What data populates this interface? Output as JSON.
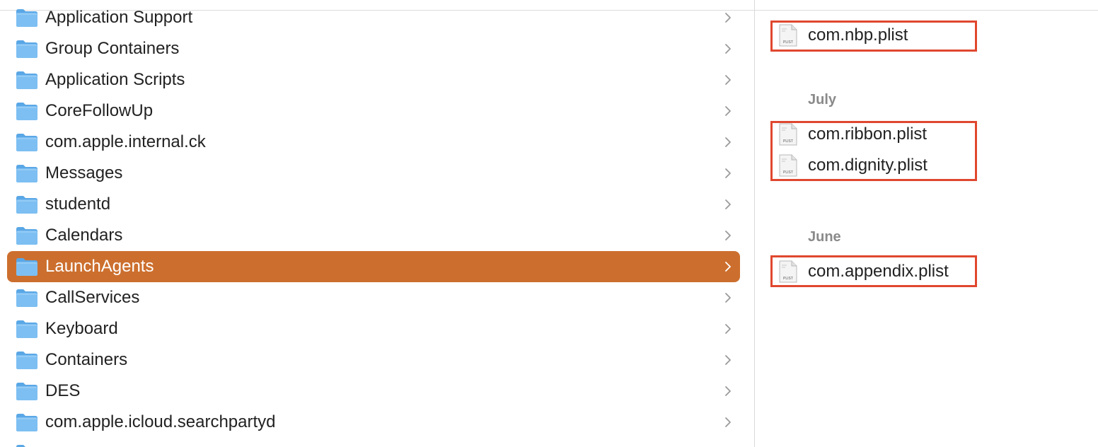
{
  "folder_list": {
    "items": [
      {
        "label": "Application Support",
        "icon": "folder-icon",
        "selected": false
      },
      {
        "label": "Group Containers",
        "icon": "folder-icon",
        "selected": false
      },
      {
        "label": "Application Scripts",
        "icon": "folder-icon",
        "selected": false
      },
      {
        "label": "CoreFollowUp",
        "icon": "folder-icon",
        "selected": false
      },
      {
        "label": "com.apple.internal.ck",
        "icon": "folder-icon",
        "selected": false
      },
      {
        "label": "Messages",
        "icon": "folder-icon",
        "selected": false
      },
      {
        "label": "studentd",
        "icon": "folder-icon",
        "selected": false
      },
      {
        "label": "Calendars",
        "icon": "folder-icon",
        "selected": false
      },
      {
        "label": "LaunchAgents",
        "icon": "folder-icon",
        "selected": true
      },
      {
        "label": "CallServices",
        "icon": "folder-icon",
        "selected": false
      },
      {
        "label": "Keyboard",
        "icon": "folder-icon",
        "selected": false
      },
      {
        "label": "Containers",
        "icon": "folder-icon",
        "selected": false
      },
      {
        "label": "DES",
        "icon": "folder-icon",
        "selected": false
      },
      {
        "label": "com.apple.icloud.searchpartyd",
        "icon": "folder-icon",
        "selected": false
      },
      {
        "label": "",
        "icon": "folder-icon",
        "selected": false
      }
    ]
  },
  "file_list": {
    "groups": [
      {
        "heading": "",
        "files": [
          "com.nbp.plist"
        ]
      },
      {
        "heading": "July",
        "files": [
          "com.ribbon.plist",
          "com.dignity.plist"
        ]
      },
      {
        "heading": "June",
        "files": [
          "com.appendix.plist"
        ]
      }
    ],
    "file_icon_text": "PLIST"
  },
  "colors": {
    "selection": "#cc6f2e",
    "highlight_box": "#e0472f",
    "folder_blue": "#6cb2ec",
    "section_heading": "#8a8a8a"
  }
}
